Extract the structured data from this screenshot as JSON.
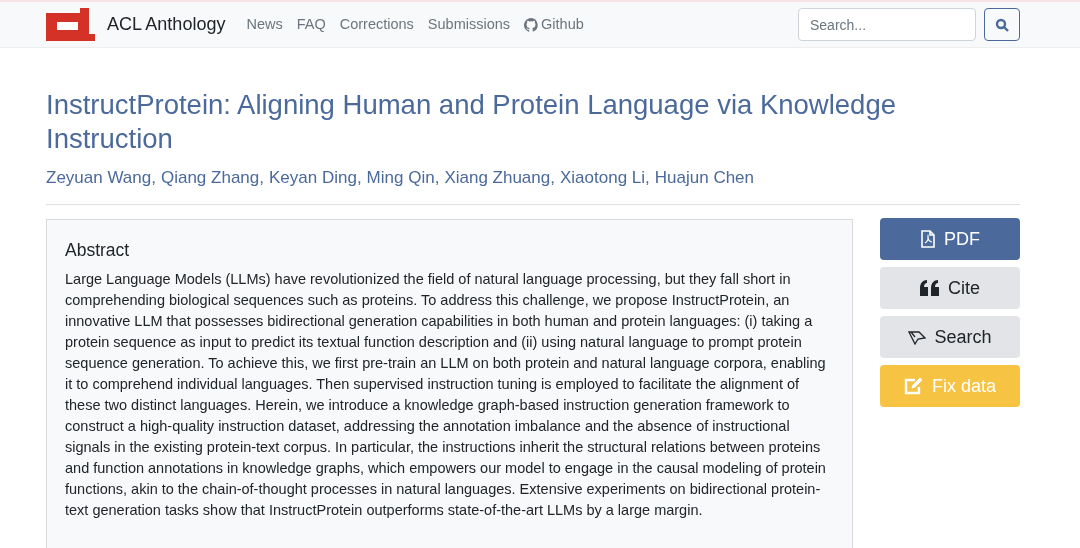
{
  "navbar": {
    "brand": "ACL Anthology",
    "links": [
      {
        "label": "News",
        "kind": "plain"
      },
      {
        "label": "FAQ",
        "kind": "plain"
      },
      {
        "label": "Corrections",
        "kind": "plain"
      },
      {
        "label": "Submissions",
        "kind": "plain"
      },
      {
        "label": "Github",
        "kind": "github"
      }
    ],
    "search": {
      "placeholder": "Search..."
    }
  },
  "paper": {
    "title": "InstructProtein: Aligning Human and Protein Language via Knowledge Instruction",
    "authors": [
      "Zeyuan Wang",
      "Qiang Zhang",
      "Keyan Ding",
      "Ming Qin",
      "Xiang Zhuang",
      "Xiaotong Li",
      "Huajun Chen"
    ],
    "author_separator": ","
  },
  "abstract": {
    "heading": "Abstract",
    "text": "Large Language Models (LLMs) have revolutionized the field of natural language processing, but they fall short in comprehending biological sequences such as proteins. To address this challenge, we propose InstructProtein, an innovative LLM that possesses bidirectional generation capabilities in both human and protein languages: (i) taking a protein sequence as input to predict its textual function description and (ii) using natural language to prompt protein sequence generation. To achieve this, we first pre-train an LLM on both protein and natural language corpora, enabling it to comprehend individual languages. Then supervised instruction tuning is employed to facilitate the alignment of these two distinct languages. Herein, we introduce a knowledge graph-based instruction generation framework to construct a high-quality instruction dataset, addressing the annotation imbalance and the absence of instructional signals in the existing protein-text corpus. In particular, the instructions inherit the structural relations between proteins and function annotations in knowledge graphs, which empowers our model to engage in the causal modeling of protein functions, akin to the chain-of-thought processes in natural languages. Extensive experiments on bidirectional protein-text generation tasks show that InstructProtein outperforms state-of-the-art LLMs by a large margin."
  },
  "actions": [
    {
      "label": "PDF",
      "kind": "pdf"
    },
    {
      "label": "Cite",
      "kind": "cite"
    },
    {
      "label": "Search",
      "kind": "search"
    },
    {
      "label": "Fix data",
      "kind": "fix"
    }
  ]
}
